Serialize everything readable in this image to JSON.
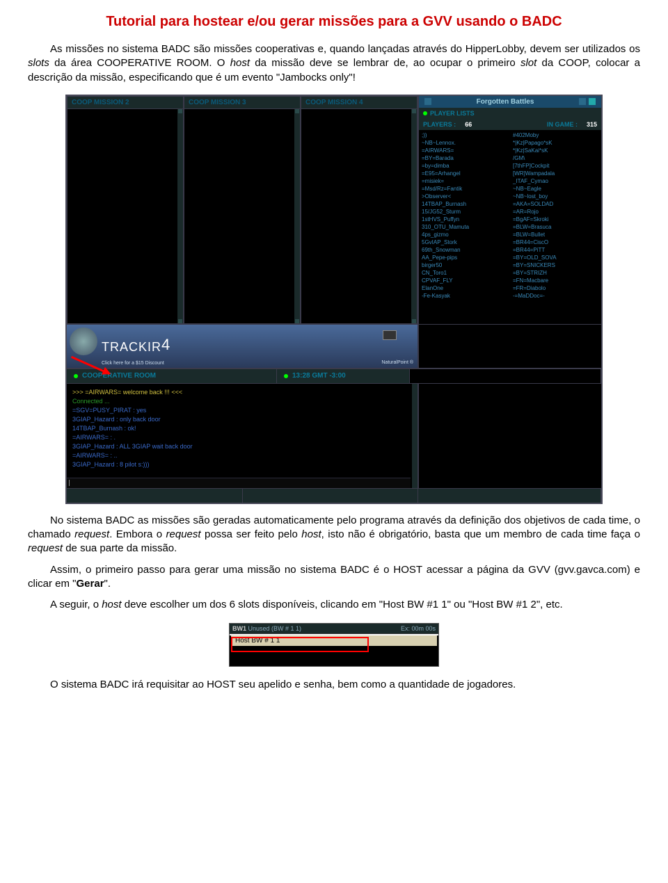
{
  "title": "Tutorial para hostear e/ou gerar missões para a GVV usando o BADC",
  "p1a": "As missões no sistema BADC são missões cooperativas e, quando lançadas através do HipperLobby, devem ser utilizados os ",
  "p1b": "slots",
  "p1c": " da área COOPERATIVE ROOM. O ",
  "p1d": "host",
  "p1e": " da missão deve se lembrar de, ao ocupar o primeiro ",
  "p1f": "slot",
  "p1g": " da COOP, colocar a descrição da missão, especificando que é um evento \"Jambocks only\"!",
  "p2a": "No sistema BADC as missões são geradas automaticamente pelo programa através da definição dos objetivos de cada time, o chamado ",
  "p2b": "request",
  "p2c": ". Embora o ",
  "p2d": "request",
  "p2e": " possa ser feito pelo ",
  "p2f": "host",
  "p2g": ", isto não é obrigatório, basta que um membro de cada time faça o ",
  "p2h": "request",
  "p2i": " de sua parte da missão.",
  "p3a": "Assim, o primeiro passo para gerar uma missão no sistema BADC é o HOST acessar a página da GVV (gvv.gavca.com) e clicar em \"",
  "p3b": "Gerar",
  "p3c": "\".",
  "p4a": "A seguir, o ",
  "p4b": "host",
  "p4c": " deve escolher um dos 6 slots disponíveis, clicando em \"Host BW #1 1\" ou \"Host BW #1 2\", etc.",
  "p5": "O sistema BADC irá requisitar ao HOST seu apelido e senha, bem como a quantidade de jogadores.",
  "ss": {
    "tabs": [
      "COOP MISSION 2",
      "COOP MISSION 3",
      "COOP MISSION 4"
    ],
    "gameTitle": "Forgotten Battles",
    "playerListsLabel": "PLAYER LISTS",
    "playersLabel": "PLAYERS :",
    "playersCount": "66",
    "inGameLabel": "IN GAME :",
    "inGameCount": "315",
    "listL": [
      ";))",
      "~NB~Lennox.",
      "=AIRWARS=",
      "=BY=Barada",
      "=by=dimba",
      "=E95=Arhangel",
      "=misiek=",
      "=Msd/Rz=Fantik",
      ">Observer<",
      "14TBAP_Burnash",
      "15/JG52_Sturm",
      "1stHVS_Puffyn",
      "310_OTU_Mamuta",
      "4ps_gizmo",
      "5GvIAP_Stork",
      "69th_Snowman",
      "AA_Pepe-pips",
      "birger50",
      "CN_Toro1",
      "CPVAF_FLY",
      "ElanOne",
      "-Fe-Kasyak"
    ],
    "listR": [
      "#402Moby",
      "*|Kz|Papago*sK",
      "*|Kz|SaKai*sK",
      "/GM\\",
      "[7thFP]Cockpit",
      "[WR]Wampadala",
      "_ITAF_Cymao",
      "~NB~Eagle",
      "~NB~lost_boy",
      "=AKA=SOLDAD",
      "=AR=Rojo",
      "=BgAF=Skroki",
      "=BLW=Brasuca",
      "=BLW=Bullet",
      "=BR44=CiscO",
      "=BR44=PiTT",
      "=BY=OLD_SOVA",
      "=BY=SNICKERS",
      "=BY=STRIZH",
      "=FN=Macbare",
      "=FR=Diabolo",
      "-=MaDDoc=-"
    ],
    "bannerBrand": "TRACKIR",
    "bannerNum": "4",
    "bannerSub": "Click here for a $15 Discount",
    "bannerNp": "NaturalPoint ®",
    "coopLabel": "COOPERATIVE ROOM",
    "timeLabel": "13:28 GMT -3:00",
    "chat": [
      {
        "cls": "c-yel",
        "t": ">>>  =AIRWARS= welcome back !!!  <<<"
      },
      {
        "cls": "c-grn",
        "t": "Connected ..."
      },
      {
        "cls": "c-blu",
        "t": "=SGV=PUSY_PIRAT : yes"
      },
      {
        "cls": "c-blu",
        "t": "3GIAP_Hazard : only back door"
      },
      {
        "cls": "c-blu",
        "t": "14TBAP_Burnash : ok!"
      },
      {
        "cls": "c-blu",
        "t": "=AIRWARS= : ."
      },
      {
        "cls": "c-blu",
        "t": "3GIAP_Hazard : ALL 3GIAP wait back door"
      },
      {
        "cls": "c-blu",
        "t": "=AIRWARS= : .."
      },
      {
        "cls": "c-blu",
        "t": "3GIAP_Hazard : 8 pilot s:)))"
      }
    ]
  },
  "ss2": {
    "hdr1": "BW1",
    "hdr2": "Unused (BW # 1 1)",
    "hdr3": "Ex: 00m 00s",
    "item": "Host BW # 1 1"
  }
}
